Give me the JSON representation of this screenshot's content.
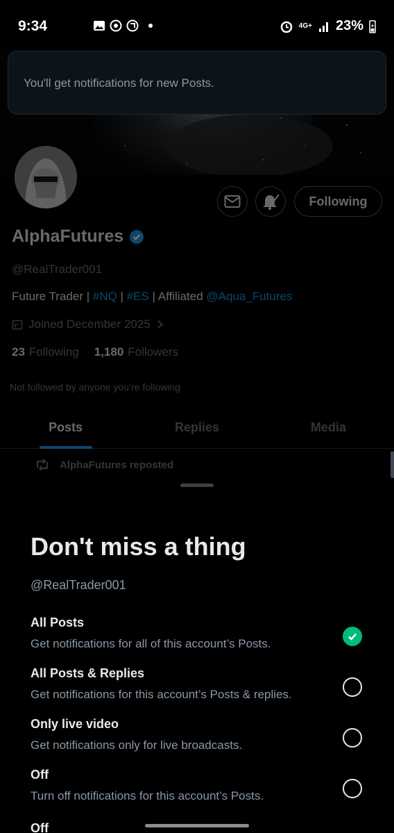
{
  "status": {
    "time": "9:34",
    "network": "4G+",
    "battery": "23%"
  },
  "toast": {
    "text": "You'll get notifications for new Posts."
  },
  "profile": {
    "name": "AlphaFutures",
    "handle": "@RealTrader001",
    "bio": {
      "prefix": "Future Trader | ",
      "tag1": "#NQ",
      "sep1": " | ",
      "tag2": "#ES",
      "sep2": " | Affiliated ",
      "mention": "@Aqua_Futures"
    },
    "joined": "Joined December 2025",
    "following_count": "23",
    "following_label": "Following",
    "followers_count": "1,180",
    "followers_label": "Followers",
    "not_followed": "Not followed by anyone you’re following",
    "following_button": "Following"
  },
  "tabs": [
    {
      "label": "Posts",
      "active": true
    },
    {
      "label": "Replies",
      "active": false
    },
    {
      "label": "Media",
      "active": false
    }
  ],
  "repost_label": "AlphaFutures reposted",
  "sheet": {
    "title": "Don't miss a thing",
    "handle": "@RealTrader001",
    "options": [
      {
        "title": "All Posts",
        "desc": "Get notifications for all of this account’s Posts.",
        "selected": true
      },
      {
        "title": "All Posts & Replies",
        "desc": "Get notifications for this account’s Posts & replies.",
        "selected": false
      },
      {
        "title": "Only live video",
        "desc": "Get notifications only for live broadcasts.",
        "selected": false
      },
      {
        "title": "Off",
        "desc": "Turn off notifications for this account’s Posts.",
        "selected": false
      }
    ],
    "cut_label": "Off"
  },
  "colors": {
    "accent": "#1d9bf0",
    "check": "#00ba7c",
    "background": "#000000"
  }
}
